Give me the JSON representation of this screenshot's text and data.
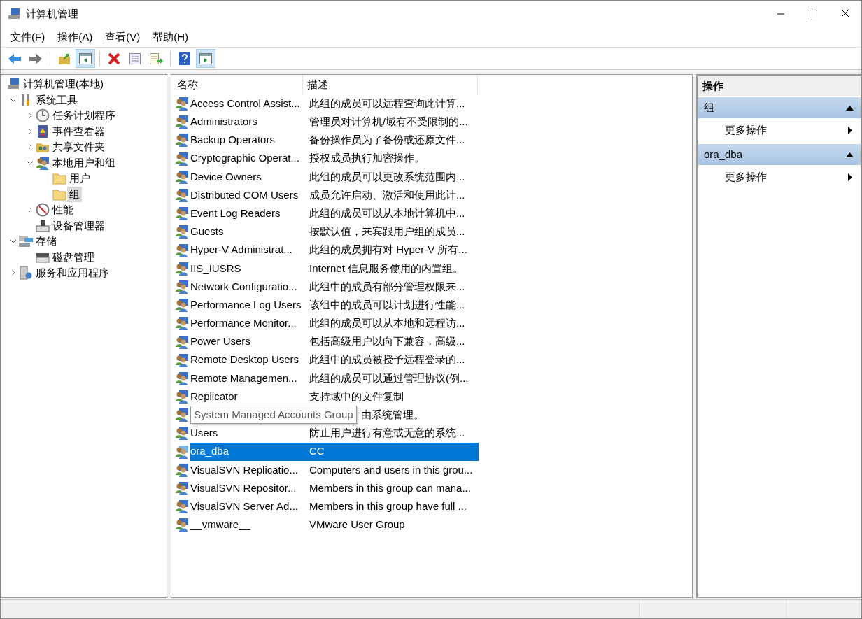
{
  "window": {
    "title": "计算机管理"
  },
  "menu": [
    "文件(F)",
    "操作(A)",
    "查看(V)",
    "帮助(H)"
  ],
  "toolbar": [
    {
      "kind": "back",
      "pressed": false
    },
    {
      "kind": "forward",
      "pressed": false
    },
    {
      "kind": "sep"
    },
    {
      "kind": "up",
      "pressed": false
    },
    {
      "kind": "tree",
      "pressed": true
    },
    {
      "kind": "sep"
    },
    {
      "kind": "delete",
      "pressed": false
    },
    {
      "kind": "properties",
      "pressed": false
    },
    {
      "kind": "export",
      "pressed": false
    },
    {
      "kind": "sep"
    },
    {
      "kind": "help",
      "pressed": false
    },
    {
      "kind": "actions",
      "pressed": true
    }
  ],
  "tree": [
    {
      "label": "计算机管理(本地)",
      "kind": "computer",
      "selected": false,
      "children": [
        {
          "label": "系统工具",
          "kind": "tools",
          "expanded": true,
          "selected": false,
          "children": [
            {
              "label": "任务计划程序",
              "kind": "clock",
              "expanded": false,
              "selected": false
            },
            {
              "label": "事件查看器",
              "kind": "event",
              "expanded": false,
              "selected": false
            },
            {
              "label": "共享文件夹",
              "kind": "share",
              "expanded": false,
              "selected": false
            },
            {
              "label": "本地用户和组",
              "kind": "users",
              "expanded": true,
              "selected": false,
              "children": [
                {
                  "label": "用户",
                  "kind": "folder",
                  "selected": false
                },
                {
                  "label": "组",
                  "kind": "folder",
                  "selected": true
                }
              ]
            },
            {
              "label": "性能",
              "kind": "perf",
              "expanded": false,
              "selected": false
            },
            {
              "label": "设备管理器",
              "kind": "device",
              "selected": false
            }
          ]
        },
        {
          "label": "存储",
          "kind": "storage",
          "expanded": true,
          "selected": false,
          "children": [
            {
              "label": "磁盘管理",
              "kind": "disk",
              "selected": false
            }
          ]
        },
        {
          "label": "服务和应用程序",
          "kind": "services",
          "expanded": false,
          "selected": false
        }
      ]
    }
  ],
  "table": {
    "columns": [
      "名称",
      "描述"
    ],
    "rows": [
      {
        "name": "Access Control Assist...",
        "description": "此组的成员可以远程查询此计算...",
        "selected": false
      },
      {
        "name": "Administrators",
        "description": "管理员对计算机/域有不受限制的...",
        "selected": false
      },
      {
        "name": "Backup Operators",
        "description": "备份操作员为了备份或还原文件...",
        "selected": false
      },
      {
        "name": "Cryptographic Operat...",
        "description": "授权成员执行加密操作。",
        "selected": false
      },
      {
        "name": "Device Owners",
        "description": "此组的成员可以更改系统范围内...",
        "selected": false
      },
      {
        "name": "Distributed COM Users",
        "description": "成员允许启动、激活和使用此计...",
        "selected": false
      },
      {
        "name": "Event Log Readers",
        "description": "此组的成员可以从本地计算机中...",
        "selected": false
      },
      {
        "name": "Guests",
        "description": "按默认值，来宾跟用户组的成员...",
        "selected": false
      },
      {
        "name": "Hyper-V Administrat...",
        "description": "此组的成员拥有对 Hyper-V 所有...",
        "selected": false
      },
      {
        "name": "IIS_IUSRS",
        "description": "Internet 信息服务使用的内置组。",
        "selected": false
      },
      {
        "name": "Network Configuratio...",
        "description": "此组中的成员有部分管理权限来...",
        "selected": false
      },
      {
        "name": "Performance Log Users",
        "description": "该组中的成员可以计划进行性能...",
        "selected": false
      },
      {
        "name": "Performance Monitor...",
        "description": "此组的成员可以从本地和远程访...",
        "selected": false
      },
      {
        "name": "Power Users",
        "description": "包括高级用户以向下兼容，高级...",
        "selected": false
      },
      {
        "name": "Remote Desktop Users",
        "description": "此组中的成员被授予远程登录的...",
        "selected": false
      },
      {
        "name": "Remote Managemen...",
        "description": "此组的成员可以通过管理协议(例...",
        "selected": false
      },
      {
        "name": "Replicator",
        "description": "支持域中的文件复制",
        "selected": false
      },
      {
        "tooltip": "System Managed Accounts Group",
        "description": "由系统管理。",
        "selected": false
      },
      {
        "name": "Users",
        "description": "防止用户进行有意或无意的系统...",
        "selected": false
      },
      {
        "name": "ora_dba",
        "description": "CC",
        "selected": true
      },
      {
        "name": "VisualSVN Replicatio...",
        "description": "Computers and users in this grou...",
        "selected": false
      },
      {
        "name": "VisualSVN Repositor...",
        "description": "Members in this group can mana...",
        "selected": false
      },
      {
        "name": "VisualSVN Server Ad...",
        "description": "Members in this group have full ...",
        "selected": false
      },
      {
        "name": "__vmware__",
        "description": "VMware User Group",
        "selected": false
      }
    ]
  },
  "actions": {
    "title": "操作",
    "sections": [
      {
        "title": "组",
        "expanded": true,
        "items": [
          "更多操作"
        ]
      },
      {
        "title": "ora_dba",
        "expanded": true,
        "items": [
          "更多操作"
        ]
      }
    ]
  }
}
